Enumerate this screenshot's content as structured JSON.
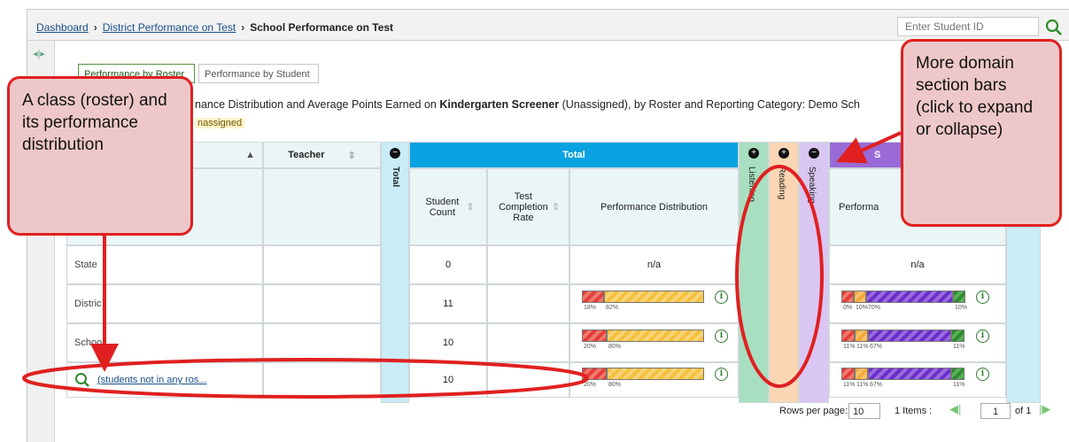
{
  "breadcrumb": {
    "dashboard": "Dashboard",
    "district": "District Performance on Test",
    "current": "School Performance on Test"
  },
  "search": {
    "placeholder": "Enter Student ID"
  },
  "tabs": [
    {
      "label": "Performance by Roster",
      "active": true
    },
    {
      "label": "Performance by Student",
      "active": false
    }
  ],
  "report": {
    "title_prefix": "nance Distribution and Average Points Earned on ",
    "test_name": "Kindergarten Screener",
    "title_suffix": " (Unassigned), by Roster and Reporting Category: Demo Sch",
    "subtitle": "nassigned"
  },
  "table": {
    "headers": {
      "teacher": "Teacher",
      "total_vertical": "Total",
      "total_group": "Total",
      "student_count": "Student Count",
      "completion": "Test Completion Rate",
      "perf_dist": "Performance Distribution",
      "listening": "Listening",
      "reading": "Reading",
      "speaking": "Speaking",
      "sp_group": "S",
      "perf_dist_right": "Performa"
    },
    "rows": [
      {
        "label": "State",
        "count": "0",
        "total_na": "n/a",
        "right_na": "n/a"
      },
      {
        "label": "Distric",
        "count": "11",
        "total_pcts": [
          "18%",
          "82%"
        ],
        "right_pcts": [
          "0%",
          "10%",
          "70%",
          "10%"
        ]
      },
      {
        "label": "Schoo",
        "count": "10",
        "total_pcts": [
          "20%",
          "80%"
        ],
        "right_pcts": [
          "11%",
          "11%",
          "67%",
          "11%"
        ]
      },
      {
        "label": "(students not in any ros...",
        "count": "10",
        "total_pcts": [
          "20%",
          "80%"
        ],
        "right_pcts": [
          "11%",
          "11%",
          "67%",
          "11%"
        ]
      }
    ]
  },
  "bars": {
    "district_total": [
      0.18,
      0.82
    ],
    "school_total": [
      0.2,
      0.8
    ],
    "roster_total": [
      0.2,
      0.8
    ],
    "district_right": [
      0.1,
      0.1,
      0.7,
      0.1
    ],
    "school_right": [
      0.11,
      0.11,
      0.67,
      0.11
    ],
    "roster_right": [
      0.11,
      0.11,
      0.67,
      0.11
    ]
  },
  "pagination": {
    "rows_per_page_label": "Rows per page:",
    "rows_per_page": "10",
    "items": "1 Items :",
    "page": "1",
    "of": "of 1"
  },
  "callouts": {
    "left": "A class (roster) and its performance distribution",
    "right": "More domain section bars (click to expand or collapse)"
  },
  "colors": {
    "total_blue": "#0aa2e0",
    "listening_green": "#a8dfc0",
    "reading_peach": "#fbd6b4",
    "speaking_lavender": "#d9c6f2",
    "sp_purple": "#9a6ad6",
    "annotation_red": "#e02020"
  }
}
